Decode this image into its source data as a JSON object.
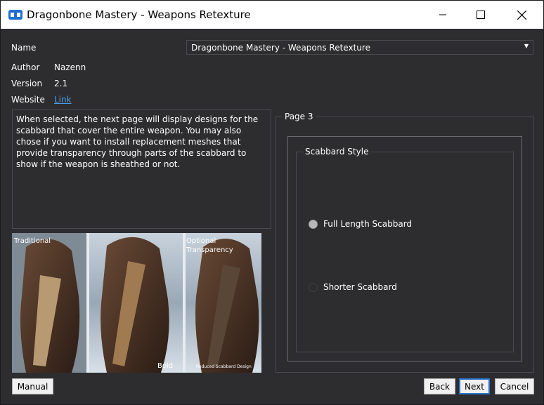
{
  "window": {
    "title": "Dragonbone Mastery - Weapons Retexture",
    "app_icon": "mod-organizer-icon"
  },
  "info": {
    "name_label": "Name",
    "name_value": "Dragonbone Mastery - Weapons Retexture",
    "author_label": "Author",
    "author_value": "Nazenn",
    "version_label": "Version",
    "version_value": "2.1",
    "website_label": "Website",
    "website_link": "Link"
  },
  "description": "When selected, the next page will display designs for the scabbard that cover the entire weapon. You may also chose if you want to install replacement meshes that provide transparency through parts of the scabbard to show if the weapon is sheathed or not.",
  "preview": {
    "caption_left": "Traditional",
    "caption_right_1": "Optional",
    "caption_right_2": "Transparency",
    "caption_bottom_mid": "Bold",
    "caption_bottom_right": "Reduced Scabbard Design"
  },
  "page": {
    "title": "Page 3",
    "group_title": "Scabbard Style",
    "options": [
      {
        "label": "Full Length Scabbard",
        "selected": true
      },
      {
        "label": "Shorter Scabbard",
        "selected": false
      }
    ]
  },
  "buttons": {
    "manual": "Manual",
    "back": "Back",
    "next": "Next",
    "cancel": "Cancel"
  },
  "colors": {
    "background": "#2d2d30",
    "link": "#4a9be8",
    "focus": "#2a72c8"
  }
}
